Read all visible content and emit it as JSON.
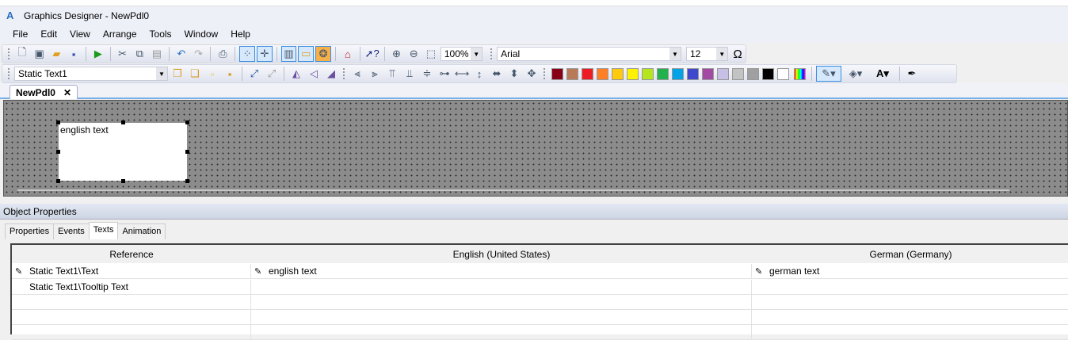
{
  "window": {
    "title": "Graphics Designer - NewPdl0"
  },
  "menu": [
    "File",
    "Edit",
    "View",
    "Arrange",
    "Tools",
    "Window",
    "Help"
  ],
  "toolbar1": {
    "zoom": "100%",
    "font": "Arial",
    "font_size": "12",
    "special_char": "Ω"
  },
  "toolbar2": {
    "object_select": "Static Text1",
    "colors": [
      "#880015",
      "#b97a57",
      "#ed1c24",
      "#ff7f27",
      "#ffc90e",
      "#fff200",
      "#b5e61d",
      "#22b14c",
      "#00a2e8",
      "#3f48cc",
      "#a349a4",
      "#c8bfe7",
      "#c3c3c3",
      "#a0a0a0",
      "#000000",
      "#ffffff"
    ]
  },
  "doc_tab": {
    "label": "NewPdl0",
    "close": "✕"
  },
  "canvas": {
    "object_text": "english text"
  },
  "object_properties": {
    "title": "Object Properties",
    "tabs": [
      "Properties",
      "Events",
      "Texts",
      "Animation"
    ],
    "active_tab": "Texts",
    "columns": [
      "Reference",
      "English (United States)",
      "German (Germany)"
    ],
    "rows": [
      {
        "reference": "Static Text1\\Text",
        "english": "english text",
        "german": "german text",
        "edit_icon": true
      },
      {
        "reference": "Static Text1\\Tooltip Text",
        "english": "",
        "german": "",
        "edit_icon": false
      }
    ]
  }
}
